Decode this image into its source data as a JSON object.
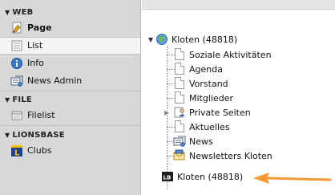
{
  "sidebar": {
    "sections": [
      {
        "title": "WEB",
        "items": [
          {
            "label": "Page",
            "icon": "page-icon",
            "bold": true
          },
          {
            "label": "List",
            "icon": "list-icon",
            "active": true
          },
          {
            "label": "Info",
            "icon": "info-icon"
          },
          {
            "label": "News Admin",
            "icon": "news-admin-icon"
          }
        ]
      },
      {
        "title": "FILE",
        "items": [
          {
            "label": "Filelist",
            "icon": "filelist-icon"
          }
        ]
      },
      {
        "title": "LIONSBASE",
        "items": [
          {
            "label": "Clubs",
            "icon": "lionsbase-icon"
          }
        ]
      }
    ]
  },
  "tree": {
    "root": {
      "label": "Kloten (48818)",
      "icon": "globe-icon"
    },
    "children": [
      {
        "label": "Soziale Aktivitäten",
        "icon": "page-icon"
      },
      {
        "label": "Agenda",
        "icon": "page-icon"
      },
      {
        "label": "Vorstand",
        "icon": "page-icon"
      },
      {
        "label": "Mitglieder",
        "icon": "page-icon"
      },
      {
        "label": "Private Seiten",
        "icon": "private-folder-icon",
        "expandable": true
      },
      {
        "label": "Aktuelles",
        "icon": "page-icon"
      },
      {
        "label": "News",
        "icon": "news-icon"
      },
      {
        "label": "Newsletters Kloten",
        "icon": "newsletter-icon"
      }
    ],
    "sysfolder": {
      "label": "Kloten (48818)",
      "icon": "lb-folder-icon",
      "badge": "LB"
    }
  },
  "colors": {
    "sidebar_bg": "#d8d8d8",
    "active_item_bg": "#f4f4f4",
    "arrow": "#f39a35"
  }
}
